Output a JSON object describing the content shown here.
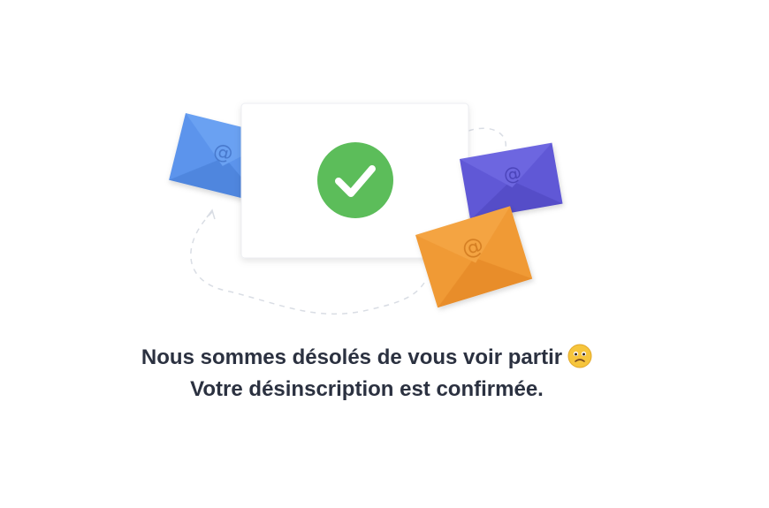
{
  "message": {
    "line1": "Nous sommes désolés de vous voir partir",
    "line1_emoji": "sad-face-icon",
    "line2": "Votre désinscription est confirmée."
  },
  "icons": {
    "check": "check-icon",
    "envelope_at_symbol": "@"
  },
  "colors": {
    "check_green": "#5cbd5a",
    "envelope_blue": "#5b94ec",
    "envelope_purple": "#6058d6",
    "envelope_orange": "#f09a36",
    "text": "#2b3140"
  }
}
